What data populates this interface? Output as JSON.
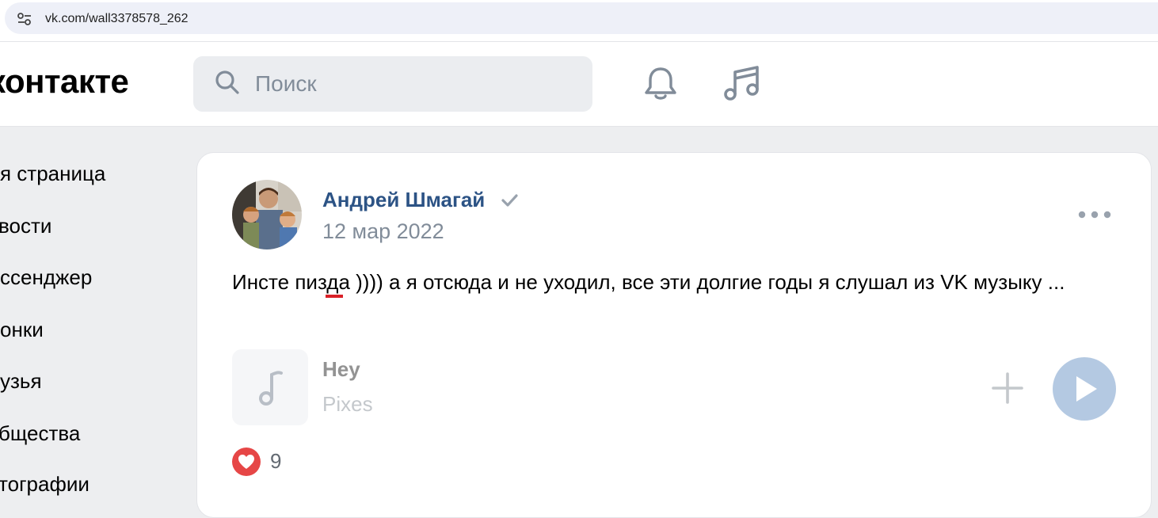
{
  "browser": {
    "url": "vk.com/wall3378578_262"
  },
  "header": {
    "logo_text": "контакте",
    "search_placeholder": "Поиск"
  },
  "sidebar": {
    "items": [
      {
        "label": "я страница"
      },
      {
        "label": "вости"
      },
      {
        "label": "ссенджер"
      },
      {
        "label": "онки"
      },
      {
        "label": "узья"
      },
      {
        "label": "бщества"
      },
      {
        "label": "тографии"
      }
    ]
  },
  "post": {
    "author": "Андрей Шмагай",
    "date": "12 мар 2022",
    "text": "Инсте пизда )))) а я отсюда и не уходил, все эти долгие годы я слушал из VK музыку ...",
    "audio": {
      "title": "Hey",
      "artist": "Pixes"
    },
    "likes": "9"
  },
  "colors": {
    "accent": "#2c5385",
    "play_button": "#b4c9e2",
    "like": "#e64646"
  }
}
